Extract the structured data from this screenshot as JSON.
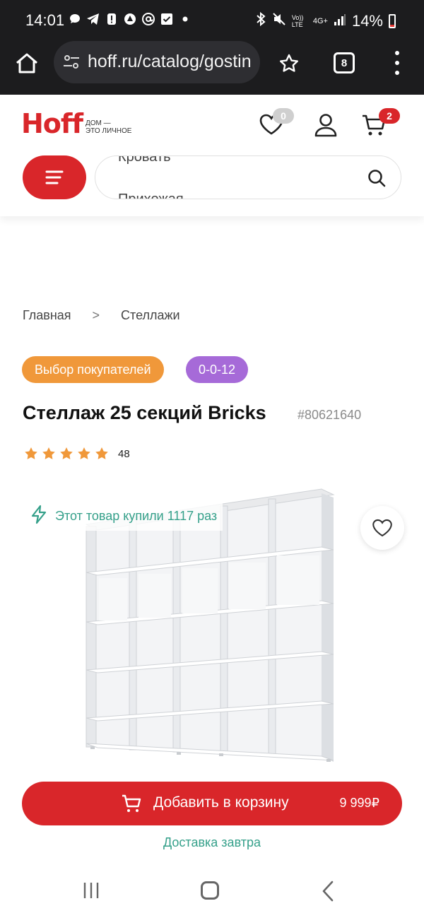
{
  "status_bar": {
    "time": "14:01",
    "battery": "14%",
    "icons_left": [
      "chat-bubble-icon",
      "telegram-icon",
      "alert-icon",
      "app-icon",
      "at-icon",
      "check-icon",
      "dot-icon"
    ],
    "icons_right": [
      "bluetooth-icon",
      "mute-icon",
      "volte-icon",
      "4g-icon",
      "signal-icon",
      "battery-icon"
    ],
    "volte_label": "Vo)) LTE",
    "net_label": "4G+"
  },
  "browser": {
    "url": "hoff.ru/catalog/gostin",
    "tabs_count": "8"
  },
  "header": {
    "logo_text": "Hoff",
    "logo_tagline_1": "ДОМ —",
    "logo_tagline_2": "ЭТО ЛИЧНОЕ",
    "favorites_count": "0",
    "cart_count": "2",
    "search_suggestions": [
      "Кровать",
      "Прихожая"
    ]
  },
  "breadcrumb": {
    "items": [
      "Главная",
      "Стеллажи"
    ],
    "separator": ">"
  },
  "tags": {
    "choice": "Выбор покупателей",
    "code": "0-0-12"
  },
  "product": {
    "title": "Стеллаж 25 секций Bricks",
    "sku": "#80621640",
    "rating_stars": 5,
    "reviews_count": "48",
    "bought_text": "Этот товар купили 1117 раз",
    "add_to_cart_label": "Добавить в корзину",
    "price": "9 999₽",
    "delivery": "Доставка завтра"
  },
  "colors": {
    "brand_red": "#d9262a",
    "tag_orange": "#f0983a",
    "tag_purple": "#a66ad8",
    "teal": "#35a08a",
    "star": "#f0983a"
  }
}
